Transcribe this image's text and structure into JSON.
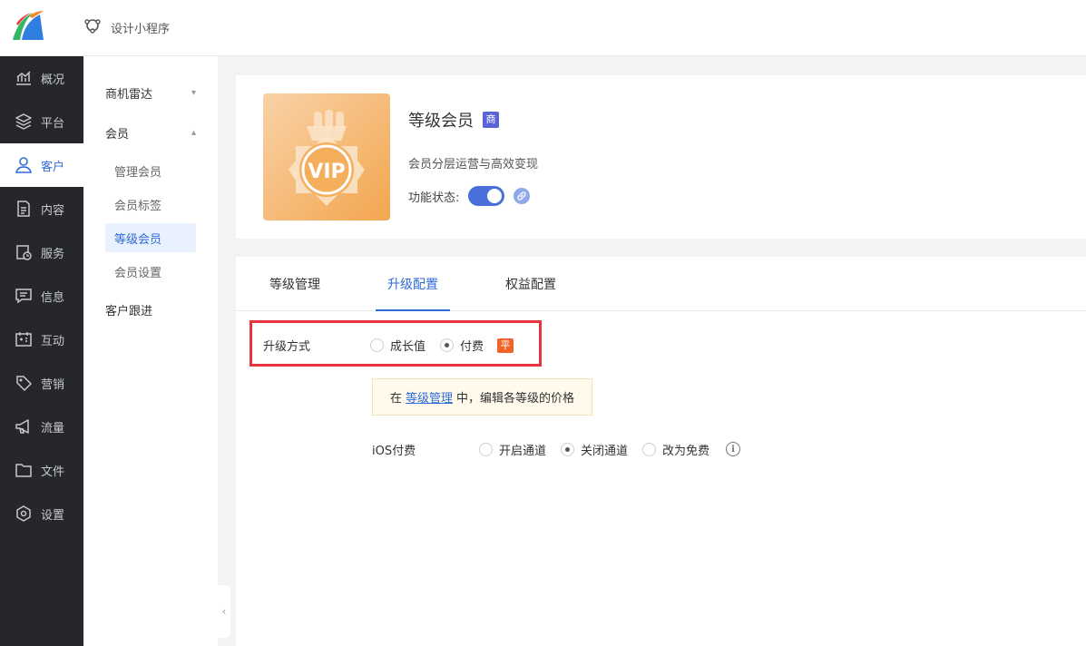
{
  "header": {
    "designer_label": "设计小程序"
  },
  "sidebar": {
    "items": [
      {
        "label": "概况",
        "icon": "chart-line-icon"
      },
      {
        "label": "平台",
        "icon": "layers-icon"
      },
      {
        "label": "客户",
        "icon": "user-icon",
        "active": true
      },
      {
        "label": "内容",
        "icon": "document-icon"
      },
      {
        "label": "服务",
        "icon": "service-clock-icon"
      },
      {
        "label": "信息",
        "icon": "message-icon"
      },
      {
        "label": "互动",
        "icon": "interact-icon"
      },
      {
        "label": "营销",
        "icon": "tag-icon"
      },
      {
        "label": "流量",
        "icon": "megaphone-icon"
      },
      {
        "label": "文件",
        "icon": "folder-icon"
      },
      {
        "label": "设置",
        "icon": "settings-icon"
      }
    ]
  },
  "submenu": {
    "group1": "商机雷达",
    "group2": "会员",
    "children": [
      "管理会员",
      "会员标签",
      "等级会员",
      "会员设置"
    ],
    "group3": "客户跟进"
  },
  "card": {
    "title": "等级会员",
    "badge": "商",
    "vip_text": "VIP",
    "description": "会员分层运营与高效变现",
    "status_label": "功能状态:"
  },
  "tabs": [
    "等级管理",
    "升级配置",
    "权益配置"
  ],
  "upgrade": {
    "label": "升级方式",
    "options": [
      "成长值",
      "付费"
    ],
    "selected": "付费",
    "tag": "平"
  },
  "notice": {
    "prefix": "在",
    "link": "等级管理",
    "suffix": "中，编辑各等级的价格"
  },
  "ios": {
    "label": "iOS付费",
    "options": [
      "开启通道",
      "关闭通道",
      "改为免费"
    ],
    "selected": "关闭通道",
    "info_glyph": "i"
  },
  "colors": {
    "accent": "#2f6bdc",
    "sidebar_bg": "#25272d",
    "highlight_border": "#e8323c"
  }
}
